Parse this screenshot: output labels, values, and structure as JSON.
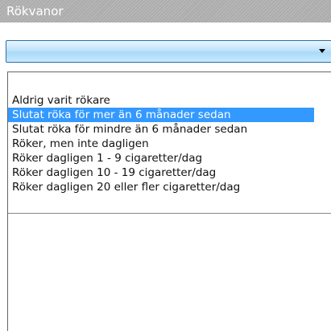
{
  "header": {
    "title": "Rökvanor"
  },
  "select": {
    "value": ""
  },
  "options": [
    "Aldrig varit rökare",
    "Slutat röka för mer än 6 månader sedan",
    "Slutat röka för mindre än 6 månader sedan",
    "Röker, men inte dagligen",
    "Röker dagligen 1 - 9 cigaretter/dag",
    "Röker dagligen 10 - 19 cigaretter/dag",
    "Röker dagligen 20 eller fler cigaretter/dag"
  ],
  "selected_option": "Slutat röka för mer än 6 månader sedan",
  "colors": {
    "highlight": "#3399ff",
    "header_bg": "#b3b3b3"
  }
}
